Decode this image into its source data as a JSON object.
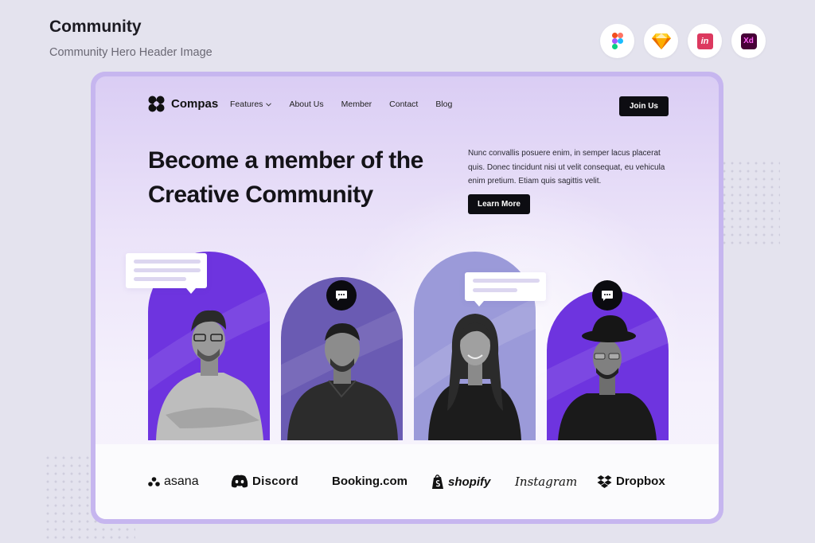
{
  "header": {
    "title": "Community",
    "subtitle": "Community Hero Header Image",
    "tools": [
      {
        "name": "figma-icon"
      },
      {
        "name": "sketch-icon"
      },
      {
        "name": "invision-icon",
        "label": "in"
      },
      {
        "name": "xd-icon",
        "label": "Xd"
      }
    ]
  },
  "site": {
    "logo": "Compas",
    "nav": [
      "Features",
      "About Us",
      "Member",
      "Contact",
      "Blog"
    ],
    "join_label": "Join Us",
    "hero_title": "Become a member of the Creative Community",
    "hero_text": "Nunc convallis posuere enim, in semper lacus placerat quis. Donec tincidunt nisi ut velit consequat, eu vehicula enim pretium. Etiam quis sagittis velit.",
    "learn_more_label": "Learn More",
    "brands": [
      "asana",
      "Discord",
      "Booking.com",
      "shopify",
      "Instagram",
      "Dropbox"
    ]
  },
  "colors": {
    "accent_purple": "#6e34df",
    "muted_purple": "#6a5bb3",
    "lavender": "#9b9ad9",
    "frame": "#c6b6ef",
    "button_dark": "#0d0d12"
  }
}
